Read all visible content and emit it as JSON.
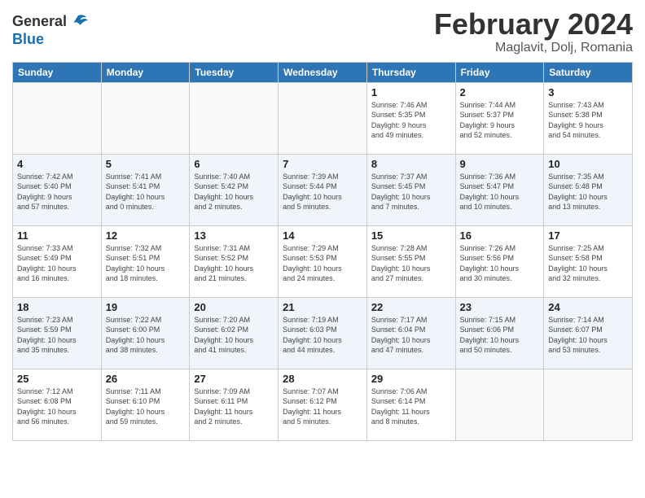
{
  "header": {
    "logo_line1": "General",
    "logo_line2": "Blue",
    "month_title": "February 2024",
    "location": "Maglavit, Dolj, Romania"
  },
  "days_of_week": [
    "Sunday",
    "Monday",
    "Tuesday",
    "Wednesday",
    "Thursday",
    "Friday",
    "Saturday"
  ],
  "weeks": [
    [
      {
        "day": "",
        "info": ""
      },
      {
        "day": "",
        "info": ""
      },
      {
        "day": "",
        "info": ""
      },
      {
        "day": "",
        "info": ""
      },
      {
        "day": "1",
        "info": "Sunrise: 7:46 AM\nSunset: 5:35 PM\nDaylight: 9 hours\nand 49 minutes."
      },
      {
        "day": "2",
        "info": "Sunrise: 7:44 AM\nSunset: 5:37 PM\nDaylight: 9 hours\nand 52 minutes."
      },
      {
        "day": "3",
        "info": "Sunrise: 7:43 AM\nSunset: 5:38 PM\nDaylight: 9 hours\nand 54 minutes."
      }
    ],
    [
      {
        "day": "4",
        "info": "Sunrise: 7:42 AM\nSunset: 5:40 PM\nDaylight: 9 hours\nand 57 minutes."
      },
      {
        "day": "5",
        "info": "Sunrise: 7:41 AM\nSunset: 5:41 PM\nDaylight: 10 hours\nand 0 minutes."
      },
      {
        "day": "6",
        "info": "Sunrise: 7:40 AM\nSunset: 5:42 PM\nDaylight: 10 hours\nand 2 minutes."
      },
      {
        "day": "7",
        "info": "Sunrise: 7:39 AM\nSunset: 5:44 PM\nDaylight: 10 hours\nand 5 minutes."
      },
      {
        "day": "8",
        "info": "Sunrise: 7:37 AM\nSunset: 5:45 PM\nDaylight: 10 hours\nand 7 minutes."
      },
      {
        "day": "9",
        "info": "Sunrise: 7:36 AM\nSunset: 5:47 PM\nDaylight: 10 hours\nand 10 minutes."
      },
      {
        "day": "10",
        "info": "Sunrise: 7:35 AM\nSunset: 5:48 PM\nDaylight: 10 hours\nand 13 minutes."
      }
    ],
    [
      {
        "day": "11",
        "info": "Sunrise: 7:33 AM\nSunset: 5:49 PM\nDaylight: 10 hours\nand 16 minutes."
      },
      {
        "day": "12",
        "info": "Sunrise: 7:32 AM\nSunset: 5:51 PM\nDaylight: 10 hours\nand 18 minutes."
      },
      {
        "day": "13",
        "info": "Sunrise: 7:31 AM\nSunset: 5:52 PM\nDaylight: 10 hours\nand 21 minutes."
      },
      {
        "day": "14",
        "info": "Sunrise: 7:29 AM\nSunset: 5:53 PM\nDaylight: 10 hours\nand 24 minutes."
      },
      {
        "day": "15",
        "info": "Sunrise: 7:28 AM\nSunset: 5:55 PM\nDaylight: 10 hours\nand 27 minutes."
      },
      {
        "day": "16",
        "info": "Sunrise: 7:26 AM\nSunset: 5:56 PM\nDaylight: 10 hours\nand 30 minutes."
      },
      {
        "day": "17",
        "info": "Sunrise: 7:25 AM\nSunset: 5:58 PM\nDaylight: 10 hours\nand 32 minutes."
      }
    ],
    [
      {
        "day": "18",
        "info": "Sunrise: 7:23 AM\nSunset: 5:59 PM\nDaylight: 10 hours\nand 35 minutes."
      },
      {
        "day": "19",
        "info": "Sunrise: 7:22 AM\nSunset: 6:00 PM\nDaylight: 10 hours\nand 38 minutes."
      },
      {
        "day": "20",
        "info": "Sunrise: 7:20 AM\nSunset: 6:02 PM\nDaylight: 10 hours\nand 41 minutes."
      },
      {
        "day": "21",
        "info": "Sunrise: 7:19 AM\nSunset: 6:03 PM\nDaylight: 10 hours\nand 44 minutes."
      },
      {
        "day": "22",
        "info": "Sunrise: 7:17 AM\nSunset: 6:04 PM\nDaylight: 10 hours\nand 47 minutes."
      },
      {
        "day": "23",
        "info": "Sunrise: 7:15 AM\nSunset: 6:06 PM\nDaylight: 10 hours\nand 50 minutes."
      },
      {
        "day": "24",
        "info": "Sunrise: 7:14 AM\nSunset: 6:07 PM\nDaylight: 10 hours\nand 53 minutes."
      }
    ],
    [
      {
        "day": "25",
        "info": "Sunrise: 7:12 AM\nSunset: 6:08 PM\nDaylight: 10 hours\nand 56 minutes."
      },
      {
        "day": "26",
        "info": "Sunrise: 7:11 AM\nSunset: 6:10 PM\nDaylight: 10 hours\nand 59 minutes."
      },
      {
        "day": "27",
        "info": "Sunrise: 7:09 AM\nSunset: 6:11 PM\nDaylight: 11 hours\nand 2 minutes."
      },
      {
        "day": "28",
        "info": "Sunrise: 7:07 AM\nSunset: 6:12 PM\nDaylight: 11 hours\nand 5 minutes."
      },
      {
        "day": "29",
        "info": "Sunrise: 7:06 AM\nSunset: 6:14 PM\nDaylight: 11 hours\nand 8 minutes."
      },
      {
        "day": "",
        "info": ""
      },
      {
        "day": "",
        "info": ""
      }
    ]
  ]
}
